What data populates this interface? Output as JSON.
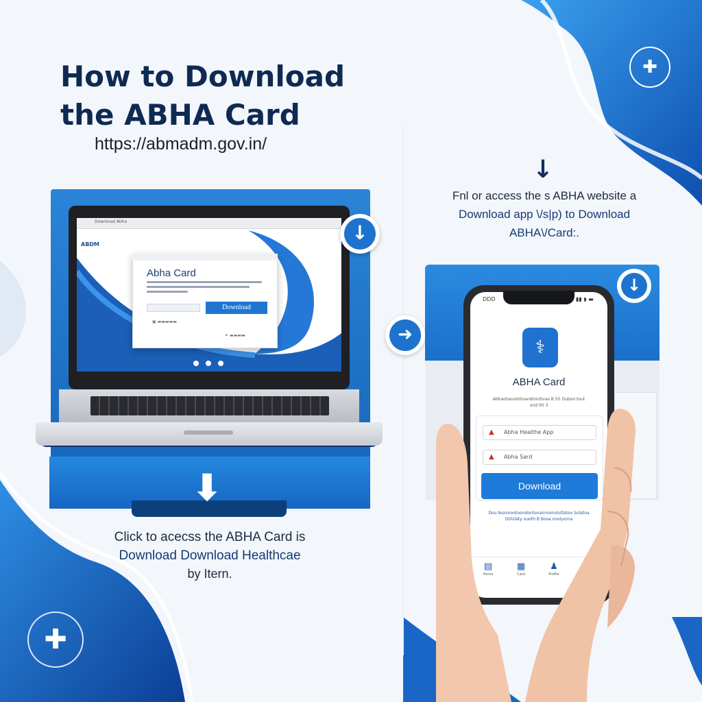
{
  "header": {
    "title_line1": "How to Download",
    "title_line2": "the ABHA Card",
    "url": "https://abmadm.gov.in/"
  },
  "laptop": {
    "browser_tab": "Download Abha",
    "site_logo": "ABDM",
    "modal_title": "Abha Card",
    "download_button": "Download",
    "download_icon": "arrow-down-icon"
  },
  "left_caption": {
    "line1": "Click to acecss the ABHA Card is",
    "line2": "Download Download Healthcae",
    "line3": "by Itern."
  },
  "right_caption": {
    "line1": "Fnl or access the s ABHA website a",
    "line2": "Download app \\/s|p) to Download",
    "line3": "ABHA\\/Card:."
  },
  "phone": {
    "status_time": "DDD",
    "status_icons": "▮▮ ◗ ▬",
    "app_title": "ABHA Card",
    "app_subtitle": "Abhaotaoutotinandinintivas B 55 Ouboo tout ond 00 3",
    "field1": "Abha Healthe App",
    "field2": "Abha Sard",
    "download_button": "Download",
    "footer_text": "Dou bozonootoondontonainnoinolutlatoo Solatoa OOUlaty ouoth B Bosa onolyorna",
    "tabs": [
      "Home",
      "Card",
      "Profile",
      "More"
    ]
  },
  "colors": {
    "primary": "#1e73cf",
    "dark_navy": "#0f2a52",
    "accent_light": "#2b84d8"
  },
  "icons": {
    "top_right_logo": "health-logo-icon",
    "bottom_left_logo": "medical-cross-icon"
  }
}
